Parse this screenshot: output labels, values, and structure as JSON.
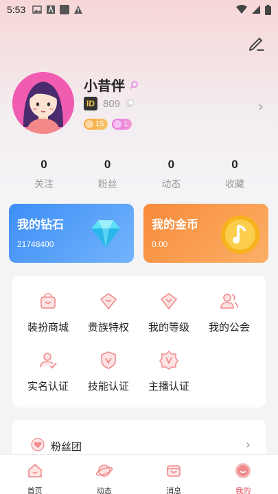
{
  "status_bar": {
    "time": "5:53"
  },
  "profile": {
    "name": "小昔伴",
    "id_tag": "ID",
    "id": "809",
    "badges": [
      {
        "value": "15"
      },
      {
        "value": "1"
      }
    ]
  },
  "stats": [
    {
      "value": "0",
      "label": "关注"
    },
    {
      "value": "0",
      "label": "粉丝"
    },
    {
      "value": "0",
      "label": "动态"
    },
    {
      "value": "0",
      "label": "收藏"
    }
  ],
  "wallet": {
    "diamond": {
      "title": "我的钻石",
      "amount": "21748400"
    },
    "gold": {
      "title": "我的金币",
      "amount": "0.00"
    }
  },
  "menu": [
    {
      "label": "装扮商城",
      "icon": "shop-bag-icon"
    },
    {
      "label": "贵族特权",
      "icon": "noble-heart-icon"
    },
    {
      "label": "我的等级",
      "icon": "level-heart-icon"
    },
    {
      "label": "我的公会",
      "icon": "guild-people-icon"
    },
    {
      "label": "实名认证",
      "icon": "verified-person-icon"
    },
    {
      "label": "技能认证",
      "icon": "skill-shield-icon"
    },
    {
      "label": "主播认证",
      "icon": "anchor-badge-icon"
    }
  ],
  "fan_club": {
    "label": "粉丝团"
  },
  "tabs": [
    {
      "label": "首页",
      "icon": "home-icon"
    },
    {
      "label": "动态",
      "icon": "planet-icon"
    },
    {
      "label": "消息",
      "icon": "message-icon"
    },
    {
      "label": "我的",
      "icon": "profile-icon",
      "active": true
    }
  ],
  "colors": {
    "accent": "#e34d59",
    "diamond": "#3e8ef7",
    "gold": "#f88a3b"
  }
}
